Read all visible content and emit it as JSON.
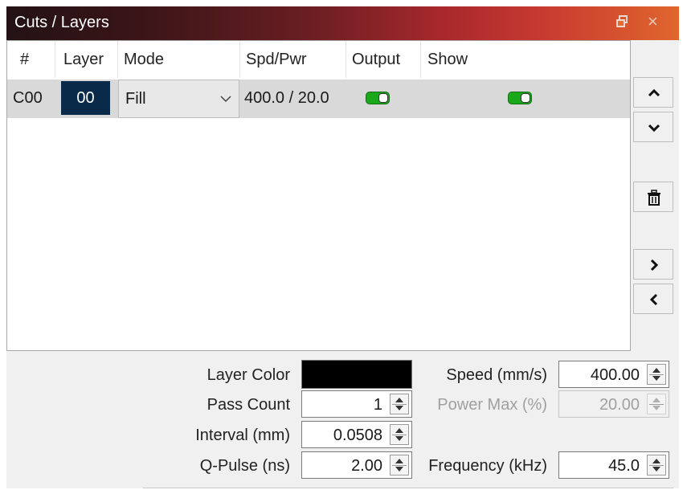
{
  "window": {
    "title": "Cuts / Layers",
    "float_icon": "float-window-icon",
    "close_label": "×"
  },
  "table": {
    "columns": [
      "#",
      "Layer",
      "Mode",
      "Spd/Pwr",
      "Output",
      "Show"
    ],
    "rows": [
      {
        "id": "C00",
        "layer": "00",
        "layer_color": "#0a2a4a",
        "mode": "Fill",
        "spd_pwr": "400.0 / 20.0",
        "output": true,
        "show": true
      }
    ]
  },
  "side_buttons": [
    {
      "name": "move-up",
      "icon": "chevron-up-icon"
    },
    {
      "name": "move-down",
      "icon": "chevron-down-icon"
    },
    {
      "name": "delete",
      "icon": "trash-icon"
    },
    {
      "name": "next",
      "icon": "chevron-right-icon"
    },
    {
      "name": "previous",
      "icon": "chevron-left-icon"
    }
  ],
  "properties": {
    "layer_color_label": "Layer Color",
    "layer_color": "#000000",
    "pass_count_label": "Pass Count",
    "pass_count": "1",
    "interval_label": "Interval (mm)",
    "interval": "0.0508",
    "qpulse_label": "Q-Pulse (ns)",
    "qpulse": "2.00",
    "speed_label": "Speed (mm/s)",
    "speed": "400.00",
    "power_max_label": "Power Max (%)",
    "power_max": "20.00",
    "frequency_label": "Frequency (kHz)",
    "frequency": "45.0"
  },
  "colors": {
    "toggle_on": "#1aa81a",
    "title_gradient_start": "#231214",
    "title_gradient_end": "#e0662e"
  }
}
